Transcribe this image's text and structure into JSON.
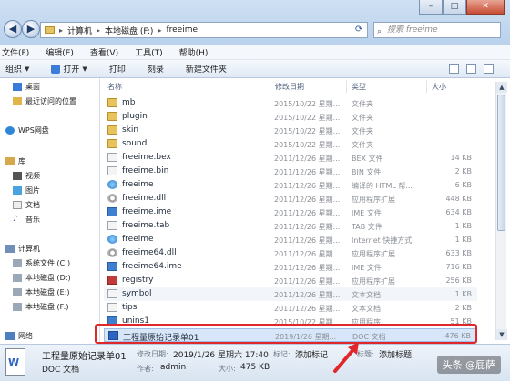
{
  "address": {
    "items": [
      "计算机",
      "本地磁盘 (F:)",
      "freeime"
    ],
    "search_placeholder": "搜索 freeime"
  },
  "menu": [
    "文件(F)",
    "编辑(E)",
    "查看(V)",
    "工具(T)",
    "帮助(H)"
  ],
  "toolbar": {
    "organize": "组织",
    "open": "打开",
    "print": "打印",
    "burn": "刻录",
    "new_folder": "新建文件夹"
  },
  "sidebar": {
    "desktop": "桌面",
    "recent": "最近访问的位置",
    "wps": "WPS网盘",
    "library": "库",
    "video": "视频",
    "pictures": "图片",
    "documents": "文档",
    "music": "音乐",
    "computer": "计算机",
    "drive_c": "系统文件 (C:)",
    "drive_d": "本地磁盘 (D:)",
    "drive_e": "本地磁盘 (E:)",
    "drive_f": "本地磁盘 (F:)",
    "network": "网络"
  },
  "columns": {
    "name": "名称",
    "date": "修改日期",
    "type": "类型",
    "size": "大小"
  },
  "files": [
    {
      "name": "mb",
      "date": "2015/10/22 星期...",
      "type": "文件夹",
      "size": "",
      "icon": "folder"
    },
    {
      "name": "plugin",
      "date": "2015/10/22 星期...",
      "type": "文件夹",
      "size": "",
      "icon": "folder"
    },
    {
      "name": "skin",
      "date": "2015/10/22 星期...",
      "type": "文件夹",
      "size": "",
      "icon": "folder"
    },
    {
      "name": "sound",
      "date": "2015/10/22 星期...",
      "type": "文件夹",
      "size": "",
      "icon": "folder"
    },
    {
      "name": "freeime.bex",
      "date": "2011/12/26 星期...",
      "type": "BEX 文件",
      "size": "14 KB",
      "icon": "file"
    },
    {
      "name": "freeime.bin",
      "date": "2011/12/26 星期...",
      "type": "BIN 文件",
      "size": "2 KB",
      "icon": "file"
    },
    {
      "name": "freeime",
      "date": "2011/12/26 星期...",
      "type": "编译的 HTML 帮...",
      "size": "6 KB",
      "icon": "globe"
    },
    {
      "name": "freeime.dll",
      "date": "2011/12/26 星期...",
      "type": "应用程序扩展",
      "size": "448 KB",
      "icon": "gear"
    },
    {
      "name": "freeime.ime",
      "date": "2011/12/26 星期...",
      "type": "IME 文件",
      "size": "634 KB",
      "icon": "exe"
    },
    {
      "name": "freeime.tab",
      "date": "2011/12/26 星期...",
      "type": "TAB 文件",
      "size": "1 KB",
      "icon": "file"
    },
    {
      "name": "freeime",
      "date": "2011/12/26 星期...",
      "type": "Internet 快捷方式",
      "size": "1 KB",
      "icon": "globe"
    },
    {
      "name": "freeime64.dll",
      "date": "2011/12/26 星期...",
      "type": "应用程序扩展",
      "size": "633 KB",
      "icon": "gear"
    },
    {
      "name": "freeime64.ime",
      "date": "2011/12/26 星期...",
      "type": "IME 文件",
      "size": "716 KB",
      "icon": "exe"
    },
    {
      "name": "registry",
      "date": "2011/12/26 星期...",
      "type": "应用程序扩展",
      "size": "256 KB",
      "icon": "reg"
    },
    {
      "name": "symbol",
      "date": "2011/12/26 星期...",
      "type": "文本文档",
      "size": "1 KB",
      "icon": "file"
    },
    {
      "name": "tips",
      "date": "2011/12/26 星期...",
      "type": "文本文档",
      "size": "2 KB",
      "icon": "file"
    },
    {
      "name": "unins1",
      "date": "2015/10/22 星期...",
      "type": "应用程序",
      "size": "51 KB",
      "icon": "exe"
    },
    {
      "name": "工程量原始记录单01",
      "date": "2019/1/26 星期...",
      "type": "DOC 文档",
      "size": "476 KB",
      "icon": "doc"
    }
  ],
  "details": {
    "name": "工程量原始记录单01",
    "type": "DOC 文档",
    "modified_label": "修改日期:",
    "modified": "2019/1/26 星期六 17:40",
    "tags_label": "标记:",
    "tags": "添加标记",
    "author_label": "作者:",
    "author": "admin",
    "size_label": "大小:",
    "size": "475 KB",
    "title_label": "标题:",
    "title": "添加标题"
  },
  "watermark": "头条 @屁萨"
}
